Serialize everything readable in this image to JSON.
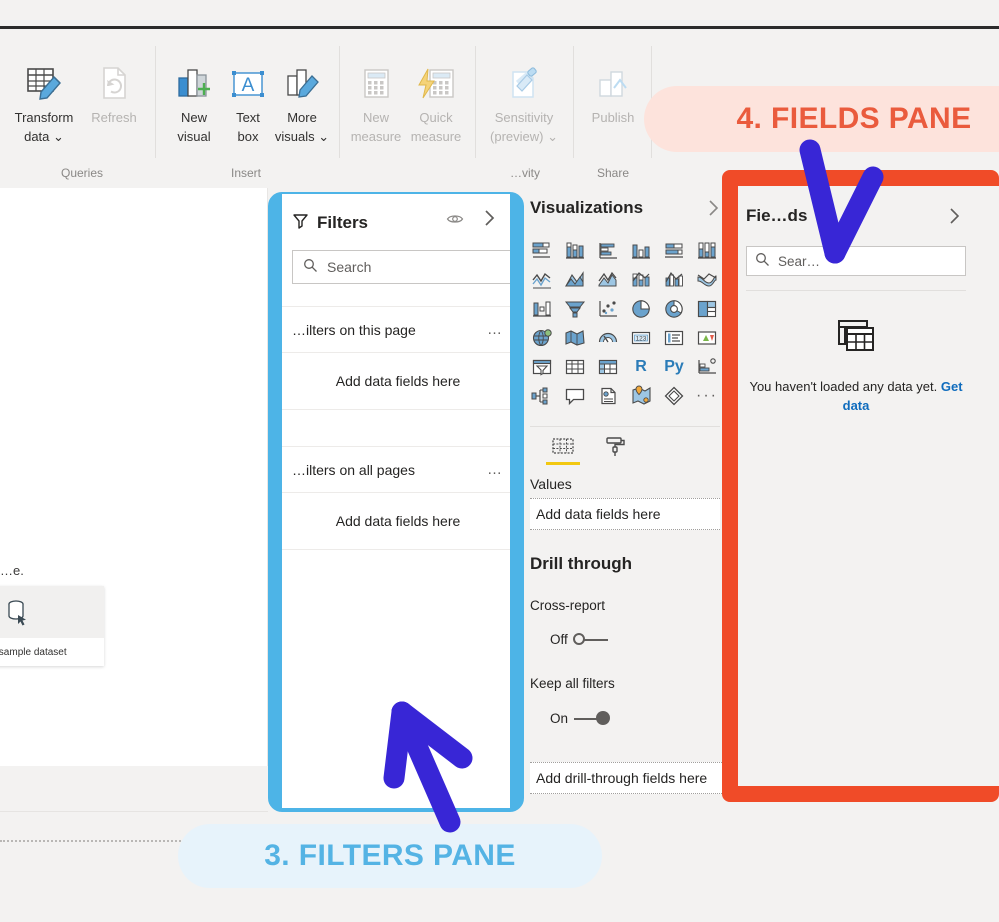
{
  "ribbon": {
    "groups": [
      {
        "name": "Queries",
        "label": "Queries",
        "items": [
          {
            "label_line1": "Transform",
            "label_line2": "data ⌄",
            "icon": "transform-data-icon",
            "disabled": false
          },
          {
            "label_line1": "Refresh",
            "label_line2": "",
            "icon": "refresh-icon",
            "disabled": true
          }
        ]
      },
      {
        "name": "Insert",
        "label": "Insert",
        "items": [
          {
            "label_line1": "New",
            "label_line2": "visual",
            "icon": "new-visual-icon",
            "disabled": false
          },
          {
            "label_line1": "Text",
            "label_line2": "box",
            "icon": "text-box-icon",
            "disabled": false
          },
          {
            "label_line1": "More",
            "label_line2": "visuals ⌄",
            "icon": "more-visuals-icon",
            "disabled": false
          }
        ]
      },
      {
        "name": "Calculations",
        "label": "",
        "items": [
          {
            "label_line1": "New",
            "label_line2": "measure",
            "icon": "new-measure-icon",
            "disabled": true
          },
          {
            "label_line1": "Quick",
            "label_line2": "measure",
            "icon": "quick-measure-icon",
            "disabled": true
          }
        ]
      },
      {
        "name": "Sensitivity",
        "label": "…vity",
        "items": [
          {
            "label_line1": "Sensitivity",
            "label_line2": "(preview) ⌄",
            "icon": "sensitivity-icon",
            "disabled": true
          }
        ]
      },
      {
        "name": "Share",
        "label": "Share",
        "items": [
          {
            "label_line1": "Publish",
            "label_line2": "",
            "icon": "publish-icon",
            "disabled": true
          }
        ]
      }
    ],
    "collapse_caret": "∧"
  },
  "canvas": {
    "note_text": "…e.",
    "sample_card_caption": "…ry a sample dataset",
    "sample_card_icon": "database-cursor-icon"
  },
  "filters": {
    "title": "Filters",
    "funnel_icon": "funnel-icon",
    "eye_icon": "eye-icon",
    "expand_icon": "chevron-right-icon",
    "search_placeholder": "Search",
    "search_value": "",
    "search_icon": "search-icon",
    "sections": [
      {
        "header": "…ilters on this page",
        "menu": "…",
        "drop_label": "Add data fields here"
      },
      {
        "header": "…ilters on all pages",
        "menu": "…",
        "drop_label": "Add data fields here"
      }
    ]
  },
  "visualizations": {
    "title": "Visualizations",
    "expand_icon": "chevron-right-icon",
    "icons": [
      "stacked-bar-chart-icon",
      "stacked-column-chart-icon",
      "clustered-bar-chart-icon",
      "clustered-column-chart-icon",
      "hundred-percent-stacked-bar-chart-icon",
      "hundred-percent-stacked-column-chart-icon",
      "line-chart-icon",
      "area-chart-icon",
      "stacked-area-chart-icon",
      "line-and-stacked-column-chart-icon",
      "line-and-clustered-column-chart-icon",
      "ribbon-chart-icon",
      "waterfall-chart-icon",
      "funnel-chart-icon",
      "scatter-chart-icon",
      "pie-chart-icon",
      "donut-chart-icon",
      "treemap-icon",
      "map-icon",
      "filled-map-icon",
      "gauge-icon",
      "card-icon",
      "multi-row-card-icon",
      "kpi-icon",
      "slicer-icon",
      "table-icon",
      "matrix-icon",
      "r-script-visual-icon",
      "python-visual-icon",
      "key-influencers-icon",
      "decomposition-tree-icon",
      "qna-icon",
      "paginated-report-icon",
      "arcgis-map-icon",
      "power-apps-icon",
      "more-options-icon"
    ],
    "tabs": [
      {
        "name": "fields-tab",
        "icon": "fields-build-icon",
        "active": true
      },
      {
        "name": "format-tab",
        "icon": "paint-roller-icon",
        "active": false
      }
    ],
    "values_label": "Values",
    "values_drop_label": "Add data fields here",
    "drill_through_title": "Drill through",
    "cross_report_label": "Cross-report",
    "cross_report_state": "Off",
    "keep_all_filters_label": "Keep all filters",
    "keep_all_filters_state": "On",
    "drill_drop_label": "Add drill-through fields here"
  },
  "fields": {
    "title": "Fie…ds",
    "expand_icon": "chevron-right-icon",
    "search_placeholder": "Sear…",
    "search_value": "",
    "search_icon": "search-icon",
    "empty_icon": "table-stack-icon",
    "empty_text": "You haven't loaded any data yet.",
    "empty_link": "Get data"
  },
  "callouts": [
    {
      "name": "fields-pane-callout",
      "text": "4. FIELDS PANE",
      "color": "#ea5b3d",
      "bg": "#fde3dc"
    },
    {
      "name": "filters-pane-callout",
      "text": "3. FILTERS PANE",
      "color": "#54b3e4",
      "bg": "#e7f3fb"
    }
  ],
  "annotations": {
    "filters_outline_color": "#4db4e7",
    "fields_outline_color": "#f04b28",
    "arrow_color": "#3826d6",
    "arrows": [
      {
        "name": "arrow-to-fields-pane",
        "direction": "down"
      },
      {
        "name": "arrow-to-filters-pane",
        "direction": "up-left"
      }
    ]
  }
}
